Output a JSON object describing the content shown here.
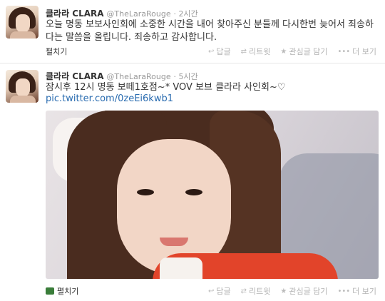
{
  "tweets": [
    {
      "name": "클라라 CLARA",
      "handle": "@TheLaraRouge",
      "time": "2시간",
      "text": "오늘 명동 보보사인회에 소중한 시간을 내어 찾아주신 분들께 다시한번 늦어서 죄송하다는 말씀을 올립니다. 죄송하고 감사합니다.",
      "expand_label": "펼치기"
    },
    {
      "name": "클라라 CLARA",
      "handle": "@TheLaraRouge",
      "time": "5시간",
      "text": "잠시후 12시 명동 보떼1호점~* VOV 보브 클라라 사인회~♡",
      "link": "pic.twitter.com/0zeEi6kwb1",
      "expand_label": "펼치기"
    }
  ],
  "actions": {
    "reply": "답글",
    "retweet": "리트윗",
    "favorite": "관심글 담기",
    "more": "더 보기"
  },
  "icons": {
    "reply": "reply-icon",
    "retweet": "retweet-icon",
    "favorite": "star-icon",
    "more": "more-icon",
    "photo_expand": "photo-icon"
  },
  "colors": {
    "link": "#2a6cb0",
    "muted": "#999999",
    "action": "#b3b3b3"
  }
}
